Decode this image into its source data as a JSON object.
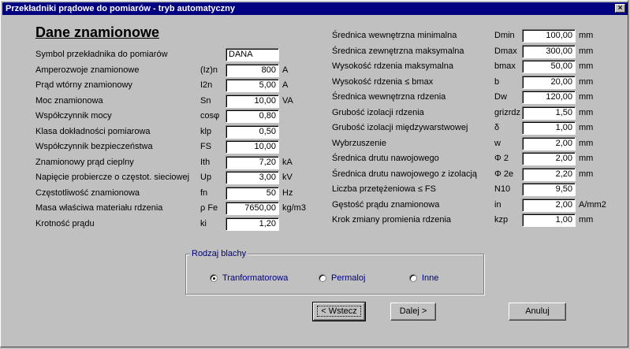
{
  "window": {
    "title": "Przekładniki prądowe do pomiarów - tryb automatyczny",
    "close": "×"
  },
  "heading": "Dane znamionowe",
  "left_rows": [
    {
      "label": "Symbol przekładnika do pomiarów",
      "symbol": "",
      "value": "DANA",
      "unit": ""
    },
    {
      "label": "Amperozwoje znamionowe",
      "symbol": "(Iz)n",
      "value": "800",
      "unit": "A"
    },
    {
      "label": "Prąd wtórny znamionowy",
      "symbol": "I2n",
      "value": "5,00",
      "unit": "A"
    },
    {
      "label": "Moc znamionowa",
      "symbol": "Sn",
      "value": "10,00",
      "unit": "VA"
    },
    {
      "label": "Współczynnik mocy",
      "symbol": "cosφ",
      "value": "0,80",
      "unit": ""
    },
    {
      "label": "Klasa dokładności pomiarowa",
      "symbol": "klp",
      "value": "0,50",
      "unit": ""
    },
    {
      "label": "Współczynnik bezpieczeństwa",
      "symbol": "FS",
      "value": "10,00",
      "unit": ""
    },
    {
      "label": "Znamionowy prąd cieplny",
      "symbol": "Ith",
      "value": "7,20",
      "unit": "kA"
    },
    {
      "label": "Napięcie probiercze o częstot. sieciowej",
      "symbol": "Up",
      "value": "3,00",
      "unit": "kV"
    },
    {
      "label": "Częstotliwość znamionowa",
      "symbol": "fn",
      "value": "50",
      "unit": "Hz"
    },
    {
      "label": "Masa właściwa materiału rdzenia",
      "symbol": "ρ Fe",
      "value": "7650,00",
      "unit": "kg/m3"
    },
    {
      "label": "Krotność prądu",
      "symbol": "ki",
      "value": "1,20",
      "unit": ""
    }
  ],
  "right_rows": [
    {
      "label": "Średnica wewnętrzna minimalna",
      "symbol": "Dmin",
      "value": "100,00",
      "unit": "mm"
    },
    {
      "label": "Średnica zewnętrzna maksymalna",
      "symbol": "Dmax",
      "value": "300,00",
      "unit": "mm"
    },
    {
      "label": "Wysokość rdzenia maksymalna",
      "symbol": "bmax",
      "value": "50,00",
      "unit": "mm"
    },
    {
      "label": "Wysokość rdzenia   ≤  bmax",
      "symbol": "b",
      "value": "20,00",
      "unit": "mm"
    },
    {
      "label": "Średnica wewnętrzna rdzenia",
      "symbol": "Dw",
      "value": "120,00",
      "unit": "mm"
    },
    {
      "label": "Grubość izolacji rdzenia",
      "symbol": "grizrdz",
      "value": "1,50",
      "unit": "mm"
    },
    {
      "label": "Grubość izolacji międzywarstwowej",
      "symbol": "δ",
      "value": "1,00",
      "unit": "mm"
    },
    {
      "label": "Wybrzuszenie",
      "symbol": "w",
      "value": "2,00",
      "unit": "mm"
    },
    {
      "label": "Średnica drutu nawojowego",
      "symbol": "Φ 2",
      "value": "2,00",
      "unit": "mm"
    },
    {
      "label": "Średnica drutu nawojowego  z izolacją",
      "symbol": "Φ 2e",
      "value": "2,20",
      "unit": "mm"
    },
    {
      "label": "Liczba przetężeniowa  ≤  FS",
      "symbol": "N10",
      "value": "9,50",
      "unit": ""
    },
    {
      "label": "Gęstość prądu znamionowa",
      "symbol": "in",
      "value": "2,00",
      "unit": "A/mm2"
    },
    {
      "label": "Krok zmiany promienia rdzenia",
      "symbol": "kzp",
      "value": "1,00",
      "unit": "mm"
    }
  ],
  "sheet_type": {
    "title": "Rodzaj blachy",
    "options": [
      {
        "label": "Tranformatorowa",
        "selected": true
      },
      {
        "label": "Permaloj",
        "selected": false
      },
      {
        "label": "Inne",
        "selected": false
      }
    ]
  },
  "buttons": {
    "back": "< Wstecz",
    "next": "Dalej >",
    "cancel": "Anuluj"
  }
}
